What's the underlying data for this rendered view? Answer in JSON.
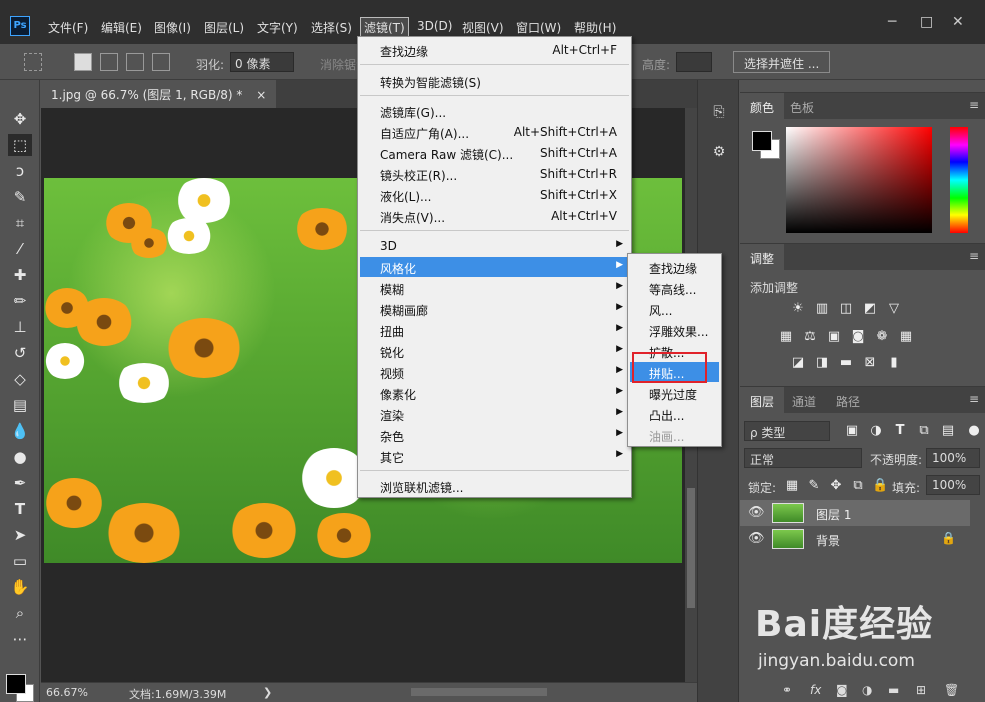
{
  "app": {
    "logo_text": "Ps",
    "menus": [
      "文件(F)",
      "编辑(E)",
      "图像(I)",
      "图层(L)",
      "文字(Y)",
      "选择(S)",
      "滤镜(T)",
      "3D(D)",
      "视图(V)",
      "窗口(W)",
      "帮助(H)"
    ],
    "window_buttons": [
      "─",
      "□",
      "✕"
    ]
  },
  "options": {
    "feather_label": "羽化:",
    "feather_value": "0 像素",
    "antialias_label": "消除锯齿",
    "height_label": "高度:",
    "select_mask_button": "选择并遮住 ..."
  },
  "document": {
    "tab_title": "1.jpg @ 66.7% (图层 1, RGB/8) *",
    "close_glyph": "×",
    "zoom": "66.67%",
    "doc_size": "文档:1.69M/3.39M",
    "status_arrow": "❯"
  },
  "filter_menu": {
    "items": [
      {
        "label": "查找边缘",
        "shortcut": "Alt+Ctrl+F"
      },
      {
        "label": "转换为智能滤镜(S)",
        "shortcut": ""
      },
      {
        "label": "滤镜库(G)...",
        "shortcut": ""
      },
      {
        "label": "自适应广角(A)...",
        "shortcut": "Alt+Shift+Ctrl+A"
      },
      {
        "label": "Camera Raw 滤镜(C)...",
        "shortcut": "Shift+Ctrl+A"
      },
      {
        "label": "镜头校正(R)...",
        "shortcut": "Shift+Ctrl+R"
      },
      {
        "label": "液化(L)...",
        "shortcut": "Shift+Ctrl+X"
      },
      {
        "label": "消失点(V)...",
        "shortcut": "Alt+Ctrl+V"
      },
      {
        "label": "3D",
        "shortcut": ""
      },
      {
        "label": "风格化",
        "shortcut": ""
      },
      {
        "label": "模糊",
        "shortcut": ""
      },
      {
        "label": "模糊画廊",
        "shortcut": ""
      },
      {
        "label": "扭曲",
        "shortcut": ""
      },
      {
        "label": "锐化",
        "shortcut": ""
      },
      {
        "label": "视频",
        "shortcut": ""
      },
      {
        "label": "像素化",
        "shortcut": ""
      },
      {
        "label": "渲染",
        "shortcut": ""
      },
      {
        "label": "杂色",
        "shortcut": ""
      },
      {
        "label": "其它",
        "shortcut": ""
      },
      {
        "label": "浏览联机滤镜...",
        "shortcut": ""
      }
    ]
  },
  "stylize_menu": {
    "items": [
      "查找边缘",
      "等高线...",
      "风...",
      "浮雕效果...",
      "扩散...",
      "拼贴...",
      "曝光过度",
      "凸出...",
      "油画..."
    ]
  },
  "panels": {
    "color_tabs": [
      "颜色",
      "色板"
    ],
    "adjust_tab": "调整",
    "adjust_title": "添加调整",
    "layers_tabs": [
      "图层",
      "通道",
      "路径"
    ],
    "kind_filter": "ρ 类型",
    "blend_mode": "正常",
    "opacity_label": "不透明度:",
    "opacity_value": "100%",
    "lock_label": "锁定:",
    "fill_label": "填充:",
    "fill_value": "100%",
    "menu_glyph": "≡",
    "layers": [
      {
        "name": "图层 1",
        "selected": true,
        "locked": false
      },
      {
        "name": "背景",
        "selected": false,
        "locked": true
      }
    ]
  },
  "watermark": {
    "logo": "Bai度经验",
    "url": "jingyan.baidu.com"
  },
  "colors": {
    "foreground": "#000000",
    "background": "#ffffff",
    "menu_highlight": "#3d8fe6",
    "annotation_box": "#e0222a"
  },
  "icons": {
    "tools": [
      "move-icon",
      "marquee-icon",
      "lasso-icon",
      "quick-select-icon",
      "crop-icon",
      "eyedropper-icon",
      "healing-icon",
      "brush-icon",
      "stamp-icon",
      "history-brush-icon",
      "eraser-icon",
      "gradient-icon",
      "blur-icon",
      "dodge-icon",
      "pen-icon",
      "type-icon",
      "path-select-icon",
      "rectangle-icon",
      "hand-icon",
      "zoom-icon",
      "more-tools-icon"
    ]
  }
}
